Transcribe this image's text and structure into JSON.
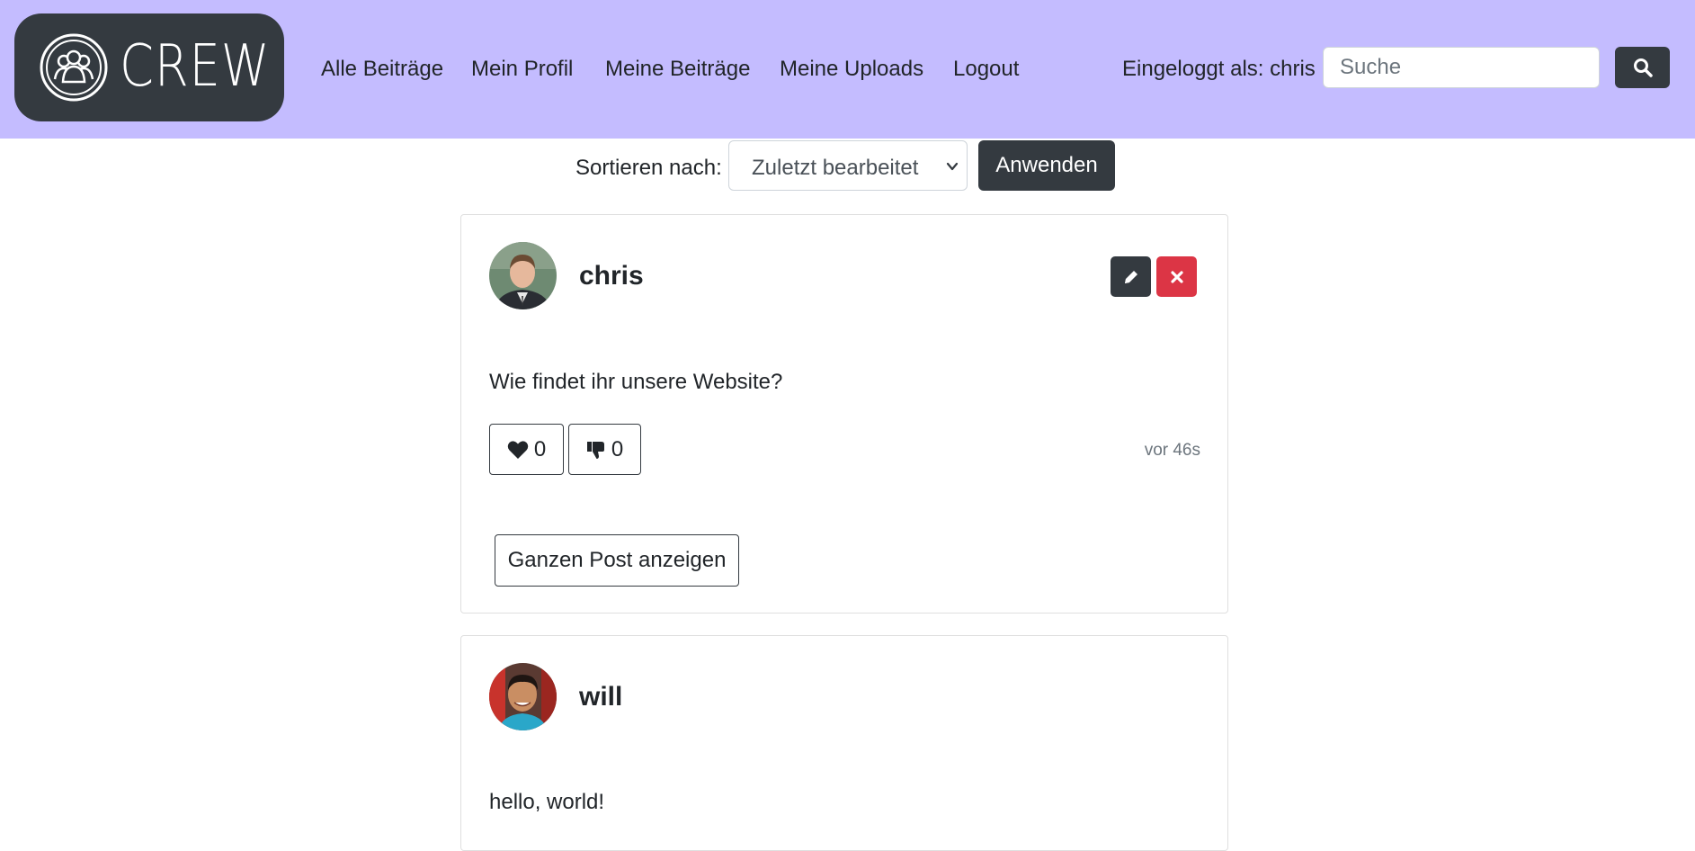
{
  "brand": {
    "name": "CREW",
    "logo_icon": "group-people-icon"
  },
  "nav": {
    "items": [
      {
        "label": "Alle Beiträge"
      },
      {
        "label": "Mein Profil"
      },
      {
        "label": "Meine Beiträge"
      },
      {
        "label": "Meine Uploads"
      },
      {
        "label": "Logout"
      }
    ],
    "logged_in_text": "Eingeloggt als: chris",
    "search": {
      "placeholder": "Suche",
      "value": "",
      "button_icon": "search-icon"
    }
  },
  "sort": {
    "label": "Sortieren nach:",
    "selected": "Zuletzt bearbeitet",
    "apply_label": "Anwenden"
  },
  "posts": [
    {
      "author": "chris",
      "text": "Wie findet ihr unsere Website?",
      "likes": "0",
      "dislikes": "0",
      "time": "vor 46s",
      "show_label": "Ganzen Post anzeigen",
      "can_edit": true
    },
    {
      "author": "will",
      "text": "hello, world!"
    }
  ],
  "colors": {
    "navbar_bg": "#c4bcff",
    "dark": "#343a40",
    "danger": "#dc3545"
  }
}
